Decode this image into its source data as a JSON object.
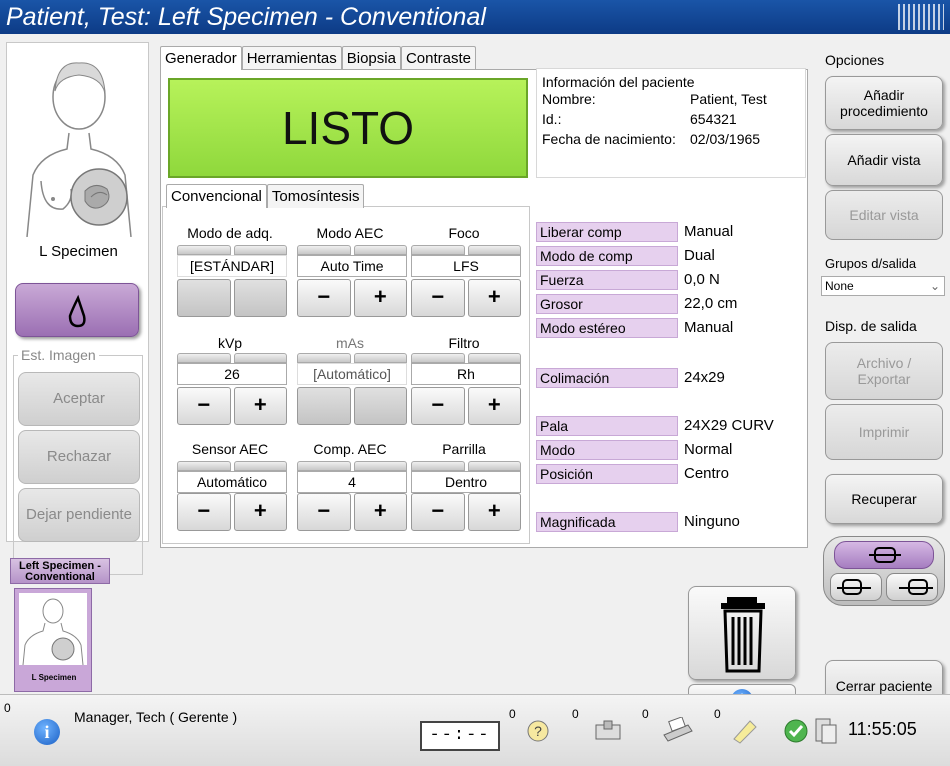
{
  "window": {
    "title": "Patient, Test:  Left Specimen - Conventional"
  },
  "left_panel": {
    "specimen_label": "L Specimen",
    "image_status_group": "Est. Imagen",
    "accept": "Aceptar",
    "reject": "Rechazar",
    "pending": "Dejar pendiente"
  },
  "tabs": [
    "Generador",
    "Herramientas",
    "Biopsia",
    "Contraste"
  ],
  "status": "LISTO",
  "patient_info": {
    "heading": "Información del paciente",
    "rows": [
      {
        "label": "Nombre:",
        "value": "Patient, Test"
      },
      {
        "label": "Id.:",
        "value": "654321"
      },
      {
        "label": "Fecha de nacimiento:",
        "value": "02/03/1965"
      }
    ]
  },
  "sub_tabs": [
    "Convencional",
    "Tomosíntesis"
  ],
  "controls": {
    "acq_mode": {
      "title": "Modo de adq.",
      "value": "[ESTÁNDAR]"
    },
    "aec_mode": {
      "title": "Modo AEC",
      "value": "Auto Time"
    },
    "focus": {
      "title": "Foco",
      "value": "LFS"
    },
    "kvp": {
      "title": "kVp",
      "value": "26"
    },
    "mas": {
      "title": "mAs",
      "value": "[Automático]"
    },
    "filter": {
      "title": "Filtro",
      "value": "Rh"
    },
    "aec_sensor": {
      "title": "Sensor AEC",
      "value": "Automático"
    },
    "aec_comp": {
      "title": "Comp. AEC",
      "value": "4"
    },
    "grid": {
      "title": "Parrilla",
      "value": "Dentro"
    },
    "minus": "−",
    "plus": "+"
  },
  "params": [
    {
      "label": "Liberar comp",
      "value": "Manual"
    },
    {
      "label": "Modo de comp",
      "value": "Dual"
    },
    {
      "label": "Fuerza",
      "value": "0,0 N"
    },
    {
      "label": "Grosor",
      "value": "22,0 cm"
    },
    {
      "label": "Modo estéreo",
      "value": "Manual"
    },
    {
      "label": "Colimación",
      "value": "24x29"
    },
    {
      "label": "Pala",
      "value": "24X29 CURV"
    },
    {
      "label": "Modo",
      "value": "Normal"
    },
    {
      "label": "Posición",
      "value": "Centro"
    },
    {
      "label": "Magnificada",
      "value": "Ninguno"
    }
  ],
  "right_panel": {
    "options": "Opciones",
    "add_procedure": "Añadir procedimiento",
    "add_view": "Añadir vista",
    "edit_view": "Editar vista",
    "output_groups": "Grupos d/salida",
    "output_groups_value": "None",
    "output_devices": "Disp. de salida",
    "archive_export": "Archivo / Exportar",
    "print": "Imprimir",
    "retrieve": "Recuperar",
    "close_patient": "Cerrar paciente"
  },
  "thumbnails": {
    "tab_label": "Left Specimen - Conventional",
    "item_label": "L Specimen"
  },
  "statusbar": {
    "alerts_count": "0",
    "user": "Manager, Tech ( Gerente )",
    "timer": "--:--",
    "counts": [
      "0",
      "0",
      "0",
      "0"
    ],
    "time": "11:55:05"
  }
}
